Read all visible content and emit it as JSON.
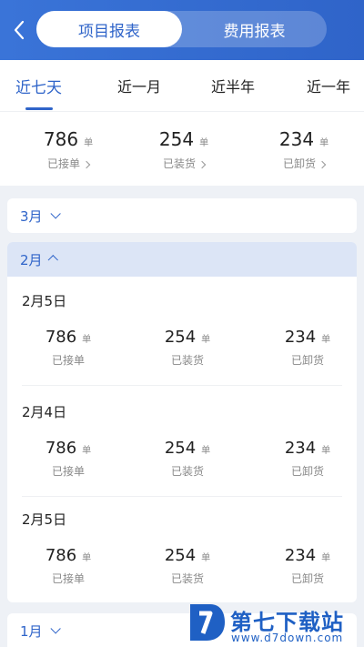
{
  "header": {
    "segment_active": "项目报表",
    "segment_inactive": "费用报表"
  },
  "tabs": [
    "近七天",
    "近一月",
    "近半年",
    "近一年"
  ],
  "summary": [
    {
      "value": "786",
      "unit": "单",
      "label": "已接单"
    },
    {
      "value": "254",
      "unit": "单",
      "label": "已装货"
    },
    {
      "value": "234",
      "unit": "单",
      "label": "已卸货"
    }
  ],
  "months": {
    "march": "3月",
    "february": "2月",
    "january": "1月"
  },
  "days": [
    {
      "date": "2月5日",
      "stats": [
        {
          "value": "786",
          "unit": "单",
          "label": "已接单"
        },
        {
          "value": "254",
          "unit": "单",
          "label": "已装货"
        },
        {
          "value": "234",
          "unit": "单",
          "label": "已卸货"
        }
      ]
    },
    {
      "date": "2月4日",
      "stats": [
        {
          "value": "786",
          "unit": "单",
          "label": "已接单"
        },
        {
          "value": "254",
          "unit": "单",
          "label": "已装货"
        },
        {
          "value": "234",
          "unit": "单",
          "label": "已卸货"
        }
      ]
    },
    {
      "date": "2月5日",
      "stats": [
        {
          "value": "786",
          "unit": "单",
          "label": "已接单"
        },
        {
          "value": "254",
          "unit": "单",
          "label": "已装货"
        },
        {
          "value": "234",
          "unit": "单",
          "label": "已卸货"
        }
      ]
    }
  ],
  "watermark": {
    "name": "第七下载站",
    "url": "www.d7down.com"
  },
  "colors": {
    "accent": "#2f64c9",
    "background": "#eef1f6"
  }
}
